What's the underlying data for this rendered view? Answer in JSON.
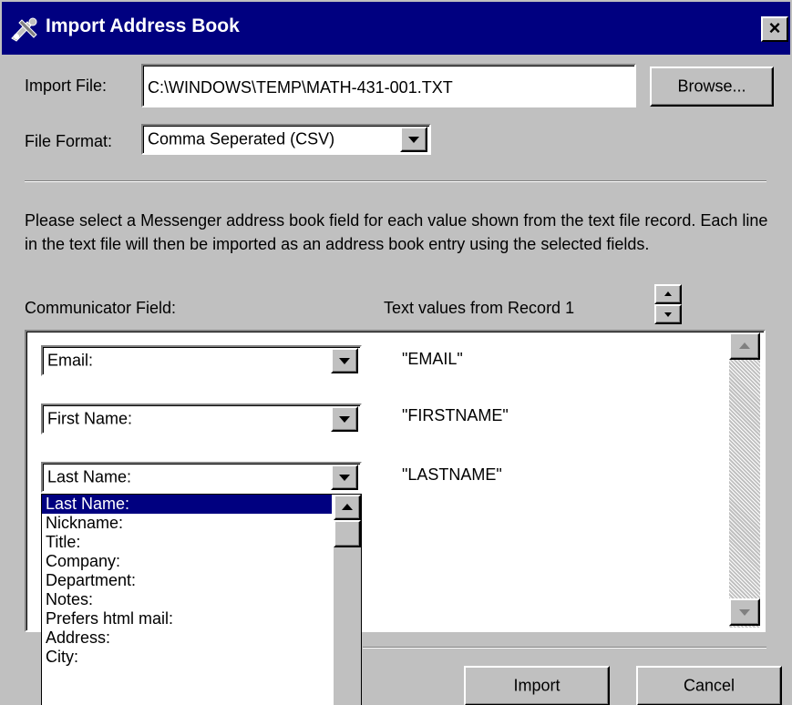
{
  "window": {
    "title": "Import Address Book",
    "close_label": "×"
  },
  "import_file": {
    "label": "Import File:",
    "value": "C:\\WINDOWS\\TEMP\\MATH-431-001.TXT",
    "browse_label": "Browse..."
  },
  "file_format": {
    "label": "File Format:",
    "value": "Comma Seperated (CSV)"
  },
  "description": "Please select a Messenger address book field for each value shown from the text file record.  Each line in the text file will then be imported as an address book entry using the selected fields.",
  "columns": {
    "field_header": "Communicator Field:",
    "values_header": "Text values from Record 1"
  },
  "rows": [
    {
      "field": "Email:",
      "value": "\"EMAIL\""
    },
    {
      "field": "First Name:",
      "value": "\"FIRSTNAME\""
    },
    {
      "field": "Last Name:",
      "value": "\"LASTNAME\""
    }
  ],
  "dropdown_options": [
    "Last Name:",
    "Nickname:",
    "Title:",
    "Company:",
    "Department:",
    "Notes:",
    "Prefers html mail:",
    "Address:",
    "City:"
  ],
  "dropdown_selected": "Last Name:",
  "buttons": {
    "import_label": "Import",
    "cancel_label": "Cancel"
  },
  "colors": {
    "titlebar": "#000080",
    "face": "#c0c0c0",
    "selection": "#000080"
  }
}
